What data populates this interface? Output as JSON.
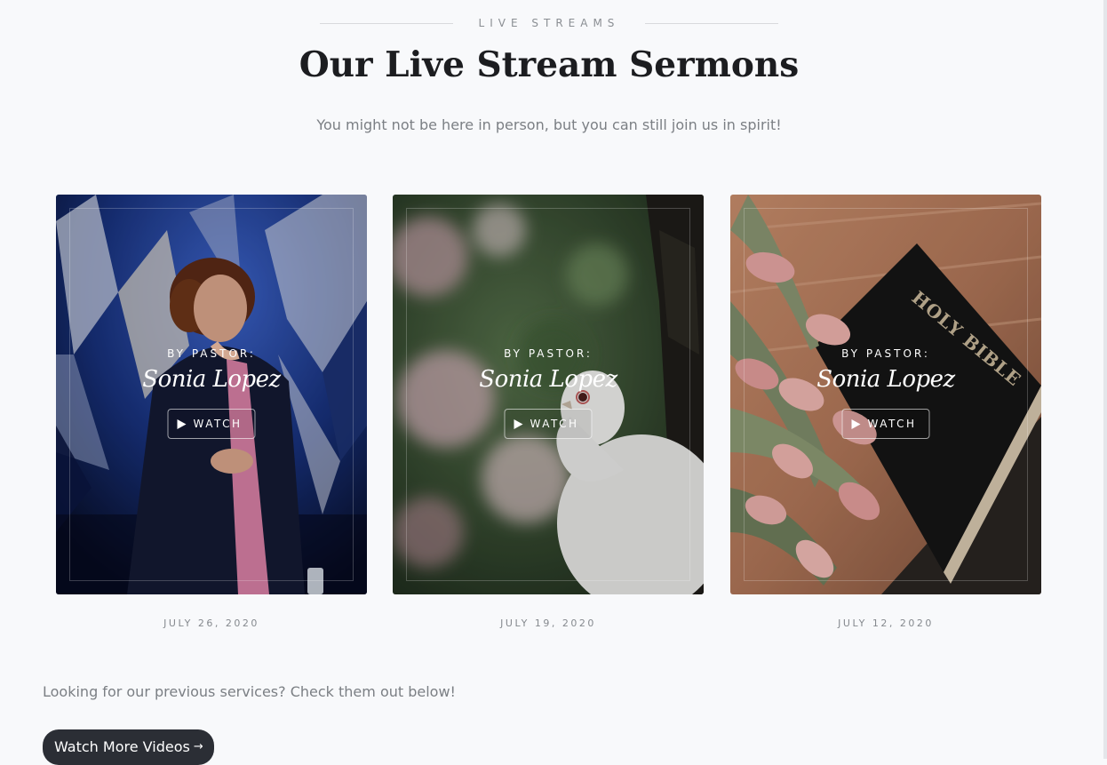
{
  "section": {
    "eyebrow": "LIVE STREAMS",
    "title": "Our Live Stream Sermons",
    "subtitle": "You might not be here in person, but you can still join us in spirit!"
  },
  "cards": [
    {
      "byline": "BY PASTOR:",
      "pastor": "Sonia Lopez",
      "watch_label": "WATCH",
      "date": "JULY 26, 2020",
      "image": "pastor-speaking-on-stage-photo"
    },
    {
      "byline": "BY PASTOR:",
      "pastor": "Sonia Lopez",
      "watch_label": "WATCH",
      "date": "JULY 19, 2020",
      "image": "white-dove-photo"
    },
    {
      "byline": "BY PASTOR:",
      "pastor": "Sonia Lopez",
      "watch_label": "WATCH",
      "date": "JULY 12, 2020",
      "image": "holy-bible-with-tulips-photo",
      "image_text": "HOLY BIBLE"
    }
  ],
  "footer": {
    "prompt": "Looking for our previous services? Check them out below!",
    "button_label": "Watch More Videos",
    "button_icon": "arrow-right-icon"
  },
  "colors": {
    "background": "#f8f9fb",
    "title": "#1c1d20",
    "muted_text": "#7b7f84",
    "button_bg": "#2b2e35"
  }
}
